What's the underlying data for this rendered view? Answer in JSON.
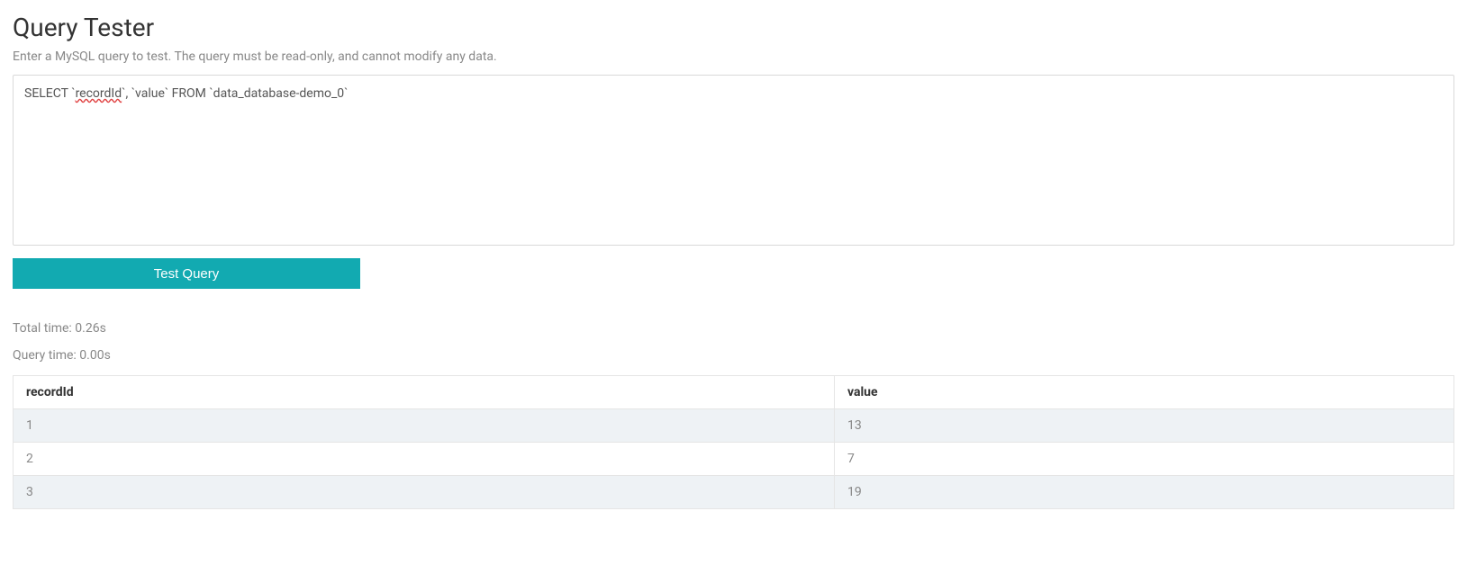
{
  "header": {
    "title": "Query Tester",
    "subtitle": "Enter a MySQL query to test. The query must be read-only, and cannot modify any data."
  },
  "query": {
    "prefix": "SELECT `",
    "spellchecked_word": "recordId",
    "suffix": "`, `value` FROM `data_database-demo_0`"
  },
  "actions": {
    "test_query_label": "Test Query"
  },
  "timing": {
    "total_time": "Total time: 0.26s",
    "query_time": "Query time: 0.00s"
  },
  "results": {
    "headers": [
      "recordId",
      "value"
    ],
    "rows": [
      {
        "recordId": "1",
        "value": "13"
      },
      {
        "recordId": "2",
        "value": "7"
      },
      {
        "recordId": "3",
        "value": "19"
      }
    ]
  }
}
